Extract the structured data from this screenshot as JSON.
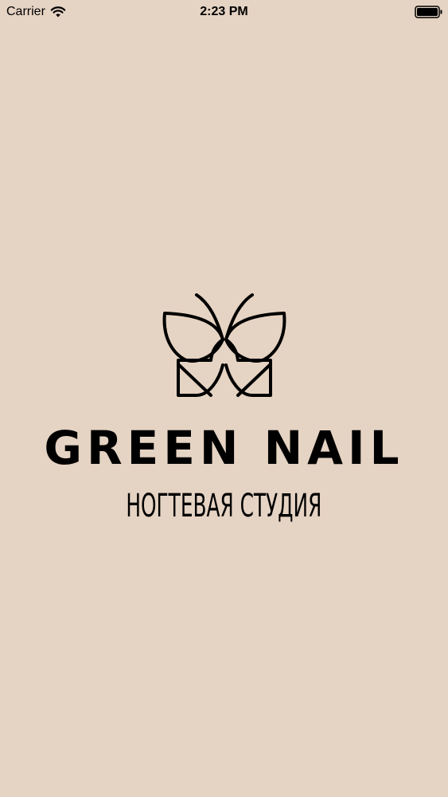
{
  "status_bar": {
    "carrier": "Carrier",
    "time": "2:23 PM",
    "icons": [
      "wifi-icon",
      "battery-icon"
    ]
  },
  "splash": {
    "logo_icon": "butterfly-icon",
    "brand_name": "GREEN NAIL",
    "subtitle": "НОГТЕВАЯ СТУДИЯ"
  },
  "colors": {
    "background": "#e5d3c3",
    "text": "#000000"
  }
}
